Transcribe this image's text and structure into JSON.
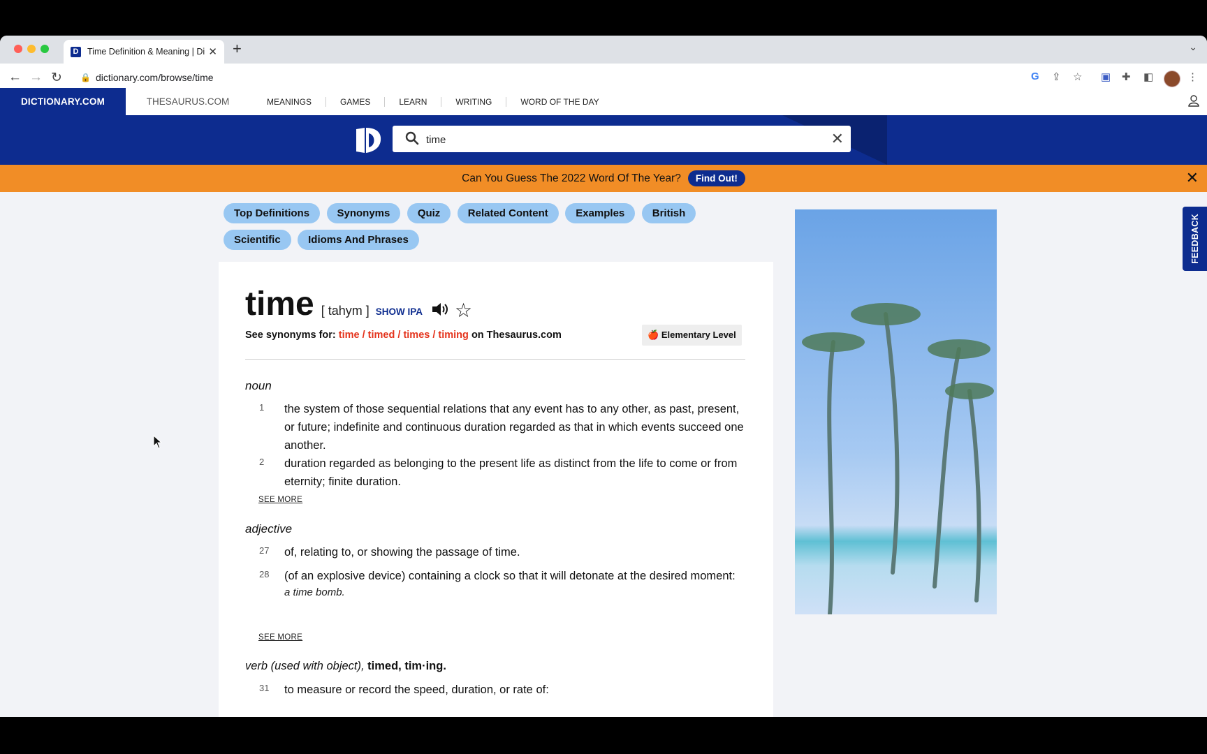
{
  "browser": {
    "tab_title": "Time Definition & Meaning | Dictionary.com",
    "favicon_letter": "D",
    "url": "dictionary.com/browse/time"
  },
  "sitenav": {
    "brand": "DICTIONARY.COM",
    "thesaurus": "THESAURUS.COM",
    "links": [
      "MEANINGS",
      "GAMES",
      "LEARN",
      "WRITING",
      "WORD OF THE DAY"
    ]
  },
  "search": {
    "value": "time"
  },
  "promo": {
    "text": "Can You Guess The 2022 Word Of The Year?",
    "button": "Find Out!"
  },
  "pills": [
    "Top Definitions",
    "Synonyms",
    "Quiz",
    "Related Content",
    "Examples",
    "British",
    "Scientific",
    "Idioms And Phrases"
  ],
  "entry": {
    "headword": "time",
    "pronunciation": "[ tahym ]",
    "show_ipa": "SHOW IPA",
    "synonyms_prefix": "See synonyms for:",
    "synonyms_words": "time / timed / times / timing",
    "synonyms_suffix": "on Thesaurus.com",
    "level": "Elementary Level",
    "level_icon": "🍎",
    "noun": {
      "label": "noun",
      "defs": [
        {
          "num": "1",
          "text": "the system of those sequential relations that any event has to any other, as past, present, or future; indefinite and continuous duration regarded as that in which events succeed one another."
        },
        {
          "num": "2",
          "text": "duration regarded as belonging to the present life as distinct from the life to come or from eternity; finite duration."
        }
      ],
      "see_more": "SEE MORE"
    },
    "adjective": {
      "label": "adjective",
      "defs": [
        {
          "num": "27",
          "text": "of, relating to, or showing the passage of time."
        },
        {
          "num": "28",
          "text": "(of an explosive device) containing a clock so that it will detonate at the desired moment:",
          "example": "a time bomb."
        }
      ],
      "see_more": "SEE MORE"
    },
    "verb": {
      "label": "verb (used with object),",
      "forms": "timed, tim·ing.",
      "defs": [
        {
          "num": "31",
          "text": "to measure or record the speed, duration, or rate of:"
        }
      ]
    }
  },
  "feedback": "FEEDBACK",
  "colors": {
    "brand_blue": "#0d2c8f",
    "promo_orange": "#f18d26",
    "pill_blue": "#98c7f2",
    "synonym_red": "#e4331c"
  }
}
